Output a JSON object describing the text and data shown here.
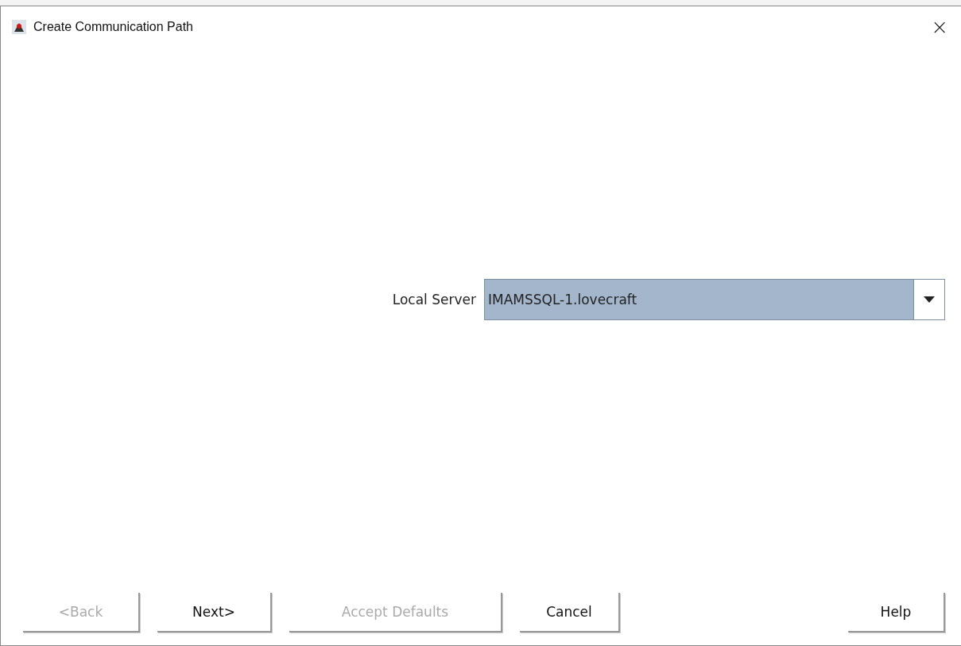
{
  "window": {
    "title": "Create Communication Path",
    "close": "×"
  },
  "form": {
    "label": "Local Server",
    "value": "IMAMSSQL-1.lovecraft",
    "selected": true
  },
  "buttons": [
    {
      "label": "<Back",
      "disabled": true
    },
    {
      "label": "Next>",
      "disabled": false
    },
    {
      "label": "Accept Defaults",
      "disabled": true
    },
    {
      "label": "Cancel",
      "disabled": false
    },
    {
      "label": "Help",
      "disabled": false,
      "kind": "right"
    }
  ]
}
